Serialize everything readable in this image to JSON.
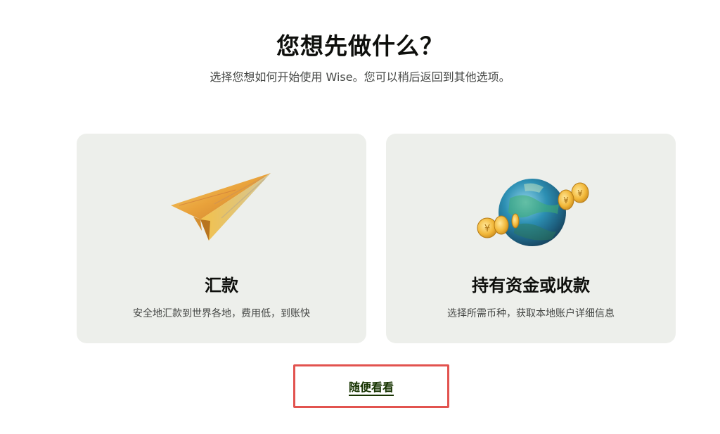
{
  "header": {
    "title": "您想先做什么？",
    "subtitle": "选择您想如何开始使用 Wise。您可以稍后返回到其他选项。"
  },
  "cards": [
    {
      "title": "汇款",
      "description": "安全地汇款到世界各地，费用低，到账快",
      "icon": "paper-plane-icon"
    },
    {
      "title": "持有资金或收款",
      "description": "选择所需币种，获取本地账户详细信息",
      "icon": "globe-coins-icon"
    }
  ],
  "skip": {
    "label": "随便看看"
  },
  "colors": {
    "card_bg": "#edefeb",
    "link": "#163300",
    "highlight_border": "#e2534f"
  }
}
